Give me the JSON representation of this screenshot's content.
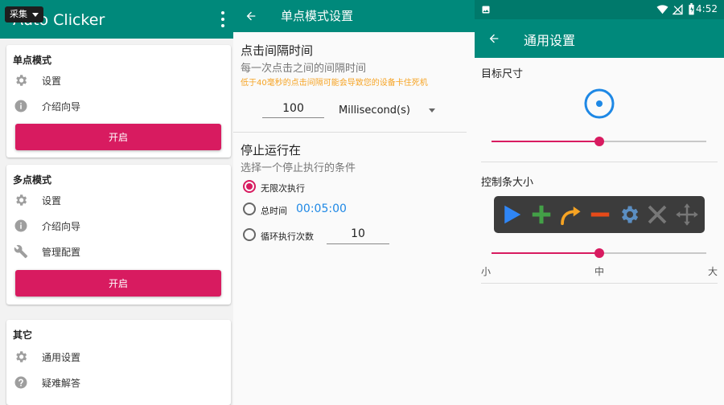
{
  "colors": {
    "teal": "#00897b",
    "teal_dark": "#00796b",
    "pink": "#d81b60",
    "warning": "#f6a323",
    "blue": "#1e88e5"
  },
  "main": {
    "app_title": "Auto Clicker",
    "chip_label": "采集",
    "single_card": {
      "title": "单点模式",
      "settings": "设置",
      "guide": "介绍向导",
      "start": "开启"
    },
    "multi_card": {
      "title": "多点模式",
      "settings": "设置",
      "guide": "介绍向导",
      "manage": "管理配置",
      "start": "开启"
    },
    "other_card": {
      "title": "其它",
      "general": "通用设置",
      "faq": "疑难解答"
    }
  },
  "single_settings": {
    "title": "单点模式设置",
    "interval": {
      "title": "点击间隔时间",
      "subtitle": "每一次点击之间的间隔时间",
      "warning": "低于40毫秒的点击间隔可能会导致您的设备卡住死机",
      "value": "100",
      "unit": "Millisecond(s)"
    },
    "stop": {
      "title": "停止运行在",
      "subtitle": "选择一个停止执行的条件",
      "options": [
        {
          "label": "无限次执行",
          "selected": true
        },
        {
          "label": "总时间",
          "selected": false
        },
        {
          "label": "循环执行次数",
          "selected": false
        }
      ],
      "time_value": "00:05:00",
      "loop_value": "10"
    }
  },
  "general_settings": {
    "status_time": "4:52",
    "title": "通用设置",
    "target_size": {
      "label": "目标尺寸",
      "level": 0.5
    },
    "control_bar_size": {
      "label": "控制条大小",
      "level": 0.5,
      "ticks": [
        "小",
        "中",
        "大"
      ],
      "toolbar_icons": [
        "play-icon",
        "plus-icon",
        "redo-arrow-icon",
        "minus-icon",
        "gear-icon",
        "close-icon",
        "move-icon"
      ]
    }
  }
}
